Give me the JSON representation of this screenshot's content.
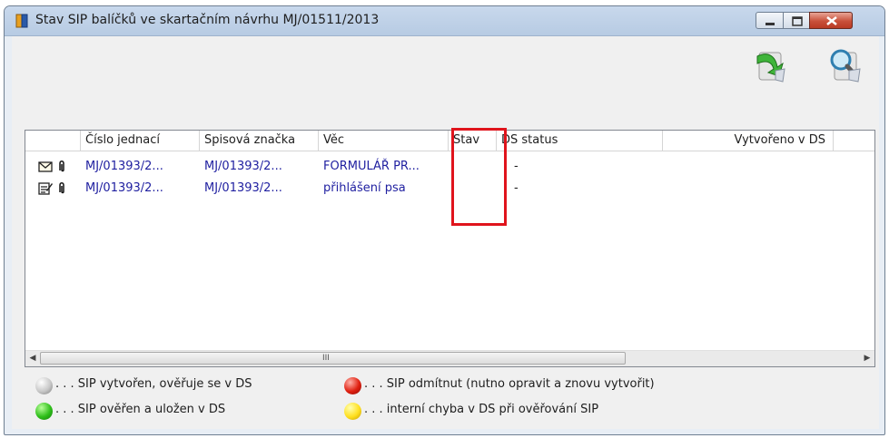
{
  "window": {
    "title": "Stav SIP balíčků ve skartačním návrhu MJ/01511/2013"
  },
  "toolbar": {
    "buttons": [
      {
        "icon": "export-arrow-icon"
      },
      {
        "icon": "magnifier-search-icon"
      }
    ]
  },
  "table": {
    "columns": [
      "Číslo jednací",
      "Spisová značka",
      "Věc",
      "Stav",
      "DS status",
      "Vytvořeno v DS"
    ],
    "rows": [
      {
        "type_icon": "envelope-icon",
        "cislo": "MJ/01393/2...",
        "spis": "MJ/01393/2...",
        "vec": "FORMULÁŘ PR...",
        "stav": "",
        "ds_status": "-",
        "vytvoreno": ""
      },
      {
        "type_icon": "document-edit-icon",
        "cislo": "MJ/01393/2...",
        "spis": "MJ/01393/2...",
        "vec": "přihlášení psa",
        "stav": "",
        "ds_status": "-",
        "vytvoreno": ""
      }
    ]
  },
  "scrollbar": {
    "left_arrow": "◀",
    "right_arrow": "▶",
    "grip": "III"
  },
  "legend": [
    {
      "color": "gray",
      "text": ". . . SIP vytvořen, ověřuje se v DS"
    },
    {
      "color": "red",
      "text": ". . . SIP odmítnut (nutno opravit a znovu vytvořit)"
    },
    {
      "color": "green",
      "text": ". . . SIP ověřen a uložen v DS"
    },
    {
      "color": "yellow",
      "text": ". . . interní chyba v DS při ověřování SIP"
    }
  ],
  "colors": {
    "link_text": "#1f1fa0",
    "highlight": "#e0141c"
  }
}
